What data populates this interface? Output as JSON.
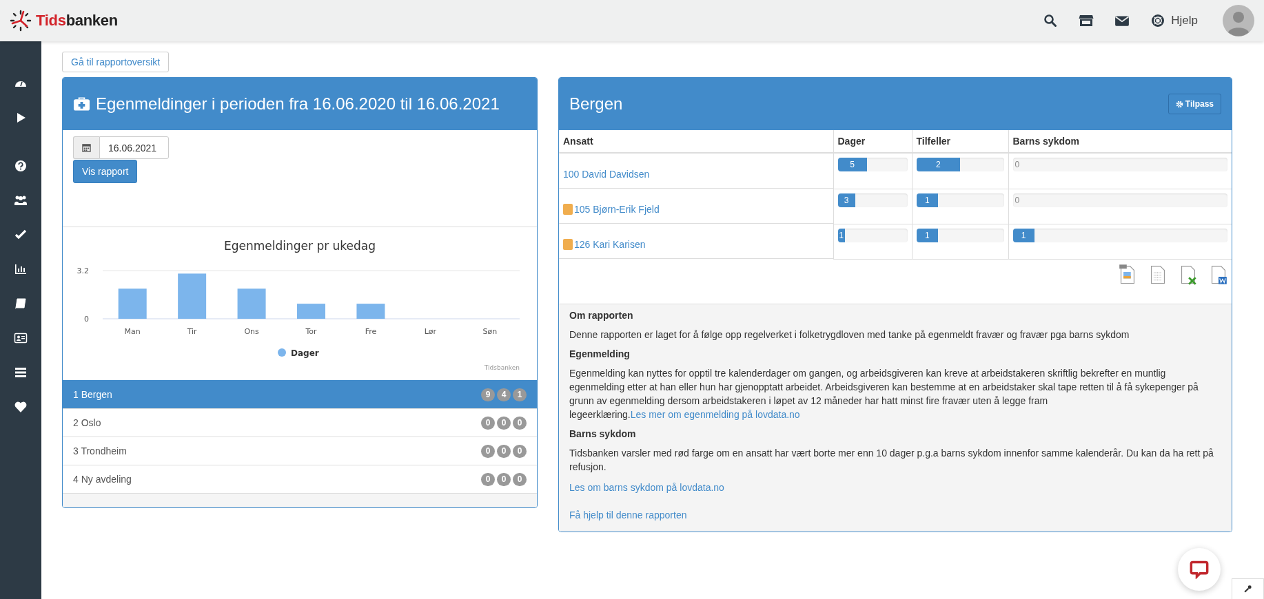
{
  "header": {
    "logo_prefix": "Tids",
    "logo_suffix": "banken",
    "help_label": "Hjelp"
  },
  "back_button": "Gå til rapportoversikt",
  "report": {
    "title": "Egenmeldinger i perioden fra 16.06.2020 til 16.06.2021",
    "date": "16.06.2021",
    "submit": "Vis rapport",
    "chart_data": {
      "type": "bar",
      "title": "Egenmeldinger pr ukedag",
      "categories": [
        "Man",
        "Tir",
        "Ons",
        "Tor",
        "Fre",
        "Lør",
        "Søn"
      ],
      "series": [
        {
          "name": "Dager",
          "color": "#7cb5ec",
          "values": [
            2,
            3,
            2,
            1,
            1,
            0,
            0
          ]
        }
      ],
      "ylim": [
        0,
        3.2
      ],
      "yticks": [
        0,
        3.2
      ]
    },
    "chart_credit": "Tidsbanken",
    "departments": [
      {
        "label": "1 Bergen",
        "selected": true,
        "counts": [
          "9",
          "4",
          "1"
        ]
      },
      {
        "label": "2 Oslo",
        "selected": false,
        "counts": [
          "0",
          "0",
          "0"
        ]
      },
      {
        "label": "3 Trondheim",
        "selected": false,
        "counts": [
          "0",
          "0",
          "0"
        ]
      },
      {
        "label": "4 Ny avdeling",
        "selected": false,
        "counts": [
          "0",
          "0",
          "0"
        ]
      }
    ]
  },
  "detail": {
    "title": "Bergen",
    "customize_button": "Tilpass",
    "columns": [
      "Ansatt",
      "Dager",
      "Tilfeller",
      "Barns sykdom"
    ],
    "rows": [
      {
        "name": "100 David Davidsen",
        "flagged": false,
        "bars": [
          {
            "value": "5",
            "level": 0.42
          },
          {
            "value": "2",
            "level": 0.5
          },
          {
            "value": "0",
            "level": 0
          }
        ]
      },
      {
        "name": "105 Bjørn-Erik Fjeld",
        "flagged": true,
        "bars": [
          {
            "value": "3",
            "level": 0.25
          },
          {
            "value": "1",
            "level": 0.25
          },
          {
            "value": "0",
            "level": 0
          }
        ]
      },
      {
        "name": "126 Kari Karisen",
        "flagged": true,
        "bars": [
          {
            "value": "1",
            "level": 0.07
          },
          {
            "value": "1",
            "level": 0.25
          },
          {
            "value": "1",
            "level": 0.1
          }
        ]
      }
    ],
    "info": [
      {
        "heading": "Om rapporten",
        "text": "Denne rapporten er laget for å følge opp regelverket i folketrygdloven med tanke på egenmeldt fravær og fravær pga barns sykdom"
      },
      {
        "heading": "Egenmelding",
        "text": "Egenmelding kan nyttes for opptil tre kalenderdager om gangen, og arbeidsgiveren kan kreve at arbeidstakeren skriftlig bekrefter en muntlig egenmelding etter at han eller hun har gjenopptatt arbeidet. Arbeidsgiveren kan bestemme at en arbeidstaker skal tape retten til å få sykepenger på grunn av egenmelding dersom arbeidstakeren i løpet av 12 måneder har hatt minst fire fravær uten å legge fram legeerklæring.",
        "link": "Les mer om egenmelding på lovdata.no"
      },
      {
        "heading": "Barns sykdom",
        "text": "Tidsbanken varsler med rød farge om en ansatt har vært borte mer enn 10 dager p.g.a barns sykdom innenfor samme kalenderår. Du kan da ha rett på refusjon.",
        "separate_link": "Les om barns sykdom på lovdata.no"
      }
    ],
    "help_link": "Få hjelp til denne rapporten"
  }
}
